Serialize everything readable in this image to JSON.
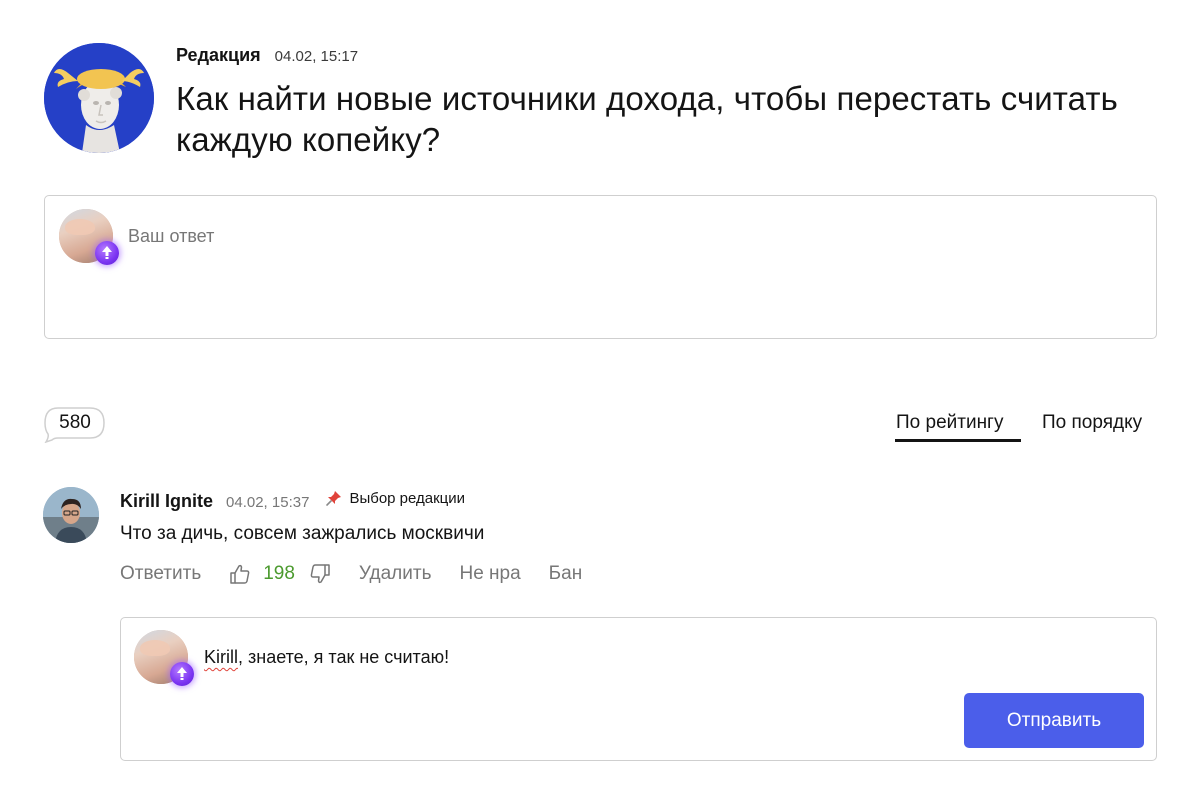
{
  "question": {
    "author": "Редакция",
    "date": "04.02, 15:17",
    "title": "Как найти новые источники дохода, чтобы перестать считать каждую копейку?",
    "avatar_icon": "hermes-statue-avatar"
  },
  "answer_box": {
    "placeholder": "Ваш ответ",
    "avatar_icon": "user-avatar-photo",
    "badge_icon": "boost-badge-icon"
  },
  "comments_count": "580",
  "sort": {
    "rating": "По рейтингу",
    "order": "По порядку",
    "active": "rating"
  },
  "comment": {
    "author": "Kirill Ignite",
    "date": "04.02, 15:37",
    "editor_pick": "Выбор редакции",
    "text": "Что за дичь, совсем зажрались москвичи",
    "actions": {
      "reply": "Ответить",
      "likes": "198",
      "delete": "Удалить",
      "dislike_label": "Не нра",
      "ban": "Бан"
    }
  },
  "reply_box": {
    "mention": "Kirill",
    "text": ", знаете, я так не считаю!",
    "send": "Отправить"
  },
  "colors": {
    "accent": "#4b5eea",
    "likes": "#4b9a2e",
    "muted": "#777777",
    "border": "#cfcfcf",
    "badge": "#7b34f2"
  }
}
